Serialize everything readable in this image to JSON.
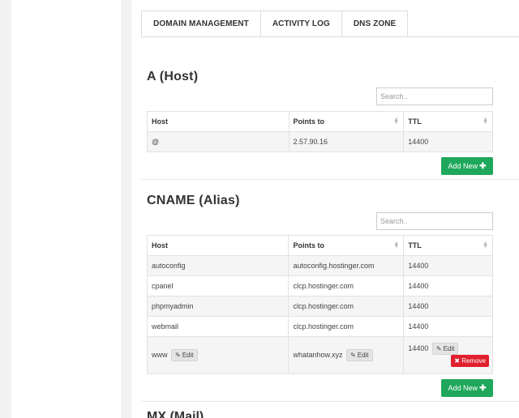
{
  "tabs": [
    {
      "label": "DOMAIN MANAGEMENT"
    },
    {
      "label": "ACTIVITY LOG"
    },
    {
      "label": "DNS ZONE"
    }
  ],
  "a_section": {
    "title": "A (Host)",
    "search_placeholder": "Search..",
    "columns": [
      "Host",
      "Points to",
      "TTL"
    ],
    "rows": [
      {
        "host": "@",
        "points_to": "2.57.90.16",
        "ttl": "14400"
      }
    ],
    "add_label": "Add New"
  },
  "cname_section": {
    "title": "CNAME (Alias)",
    "search_placeholder": "Search..",
    "columns": [
      "Host",
      "Points to",
      "TTL"
    ],
    "rows": [
      {
        "host": "autoconfig",
        "points_to": "autoconfig.hostinger.com",
        "ttl": "14400"
      },
      {
        "host": "cpanel",
        "points_to": "clcp.hostinger.com",
        "ttl": "14400"
      },
      {
        "host": "phpmyadmin",
        "points_to": "clcp.hostinger.com",
        "ttl": "14400"
      },
      {
        "host": "webmail",
        "points_to": "clcp.hostinger.com",
        "ttl": "14400"
      },
      {
        "host": "www",
        "points_to": "whatanhow.xyz",
        "ttl": "14400"
      }
    ],
    "edit_label": "Edit",
    "remove_label": "Remove",
    "add_label": "Add New"
  },
  "next_section": {
    "title": "MX (Mail)"
  },
  "icons": {
    "edit": "pencil-square-icon",
    "remove": "x-icon",
    "add": "plus-icon",
    "sort": "sort-arrows-icon"
  },
  "colors": {
    "add_button": "#1fa85b",
    "remove_button": "#e0202c"
  }
}
